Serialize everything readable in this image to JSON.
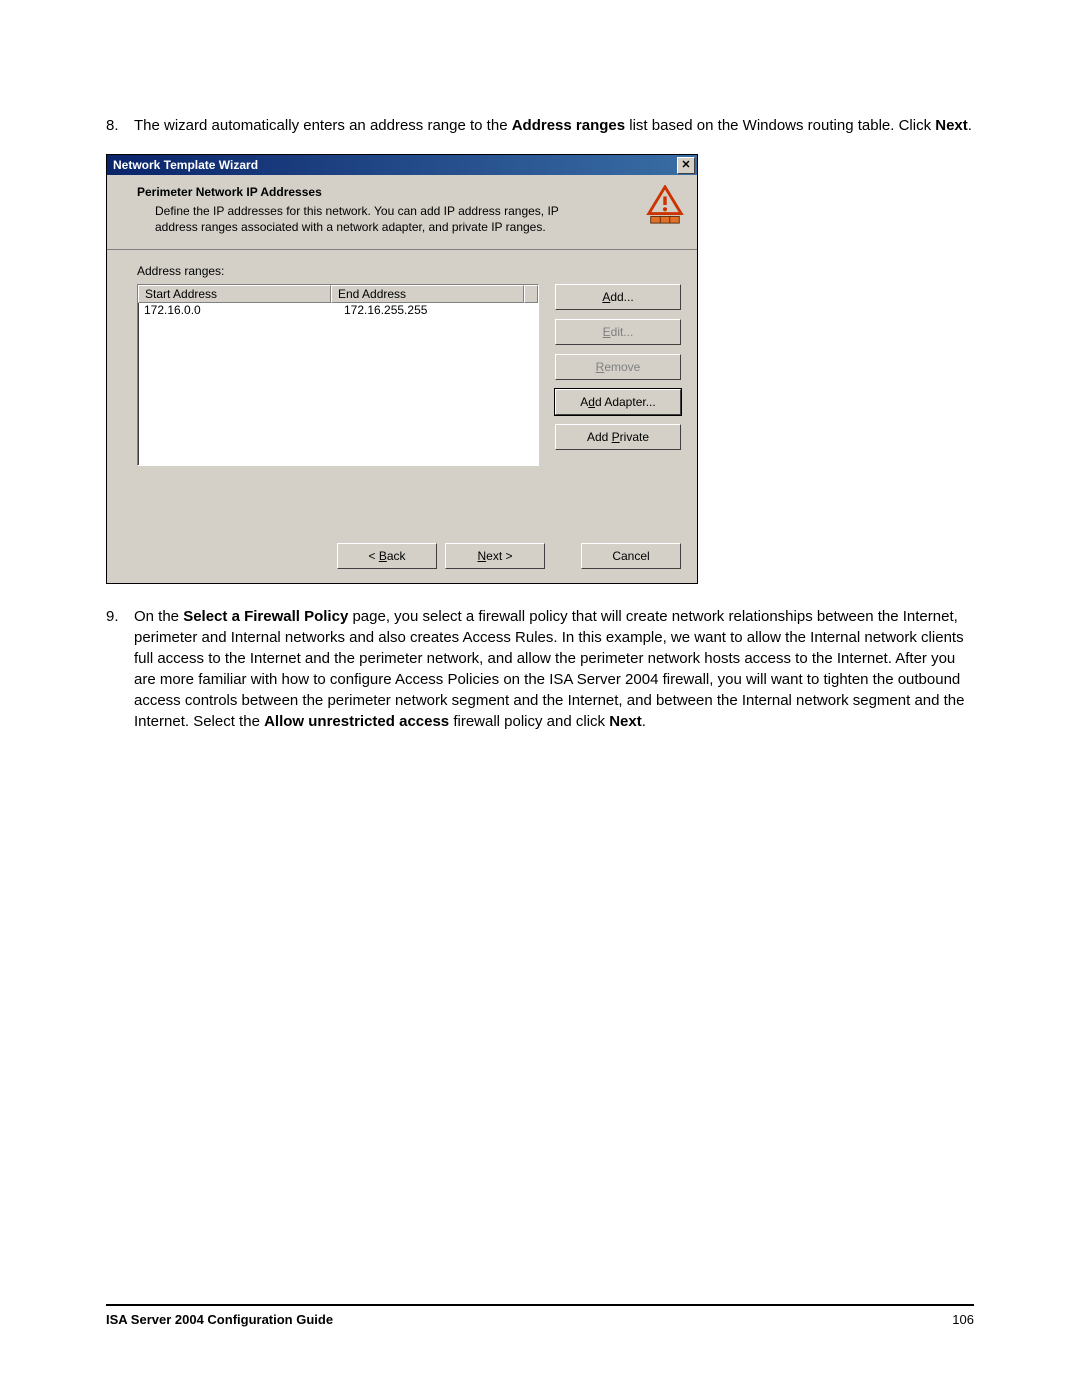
{
  "steps": [
    {
      "num": "8.",
      "html": "The wizard automatically enters an address range to the <b>Address ranges</b> list based on the Windows routing table. Click <b>Next</b>."
    },
    {
      "num": "9.",
      "html": "On the <b>Select a Firewall Policy</b> page, you select a firewall policy that will create network relationships between the Internet, perimeter and Internal networks and also creates Access Rules. In this example, we want to allow the Internal network clients full access to the Internet and the perimeter network, and allow the perimeter network hosts access to the Internet. After you are more familiar with how to configure Access Policies on the ISA Server 2004 firewall, you will want to tighten the outbound access controls between the perimeter network segment and the Internet, and between the Internal network segment and the Internet. Select the <b>Allow unrestricted access</b> firewall policy and click <b>Next</b>."
    }
  ],
  "dialog": {
    "title": "Network Template Wizard",
    "close_glyph": "✕",
    "header_title": "Perimeter Network IP Addresses",
    "header_desc": "Define the IP addresses for this network. You can add IP address ranges, IP address ranges associated with a network adapter, and private IP ranges.",
    "addr_label": "Address ranges:",
    "columns": {
      "start": "Start Address",
      "end": "End Address"
    },
    "rows": [
      {
        "start": "172.16.0.0",
        "end": "172.16.255.255"
      }
    ],
    "buttons": {
      "add": {
        "pre": "",
        "u": "A",
        "post": "dd...",
        "disabled": false
      },
      "edit": {
        "pre": "",
        "u": "E",
        "post": "dit...",
        "disabled": true
      },
      "remove": {
        "pre": "",
        "u": "R",
        "post": "emove",
        "disabled": true
      },
      "addAdapter": {
        "pre": "A",
        "u": "d",
        "post": "d Adapter...",
        "disabled": false,
        "default": true
      },
      "addPrivate": {
        "pre": "Add ",
        "u": "P",
        "post": "rivate",
        "disabled": false
      }
    },
    "nav": {
      "back": {
        "pre": "< ",
        "u": "B",
        "post": "ack"
      },
      "next": {
        "pre": "",
        "u": "N",
        "post": "ext >"
      },
      "cancel": {
        "pre": "",
        "u": "",
        "post": "Cancel"
      }
    }
  },
  "footer": {
    "title": "ISA Server 2004 Configuration Guide",
    "page": "106"
  }
}
